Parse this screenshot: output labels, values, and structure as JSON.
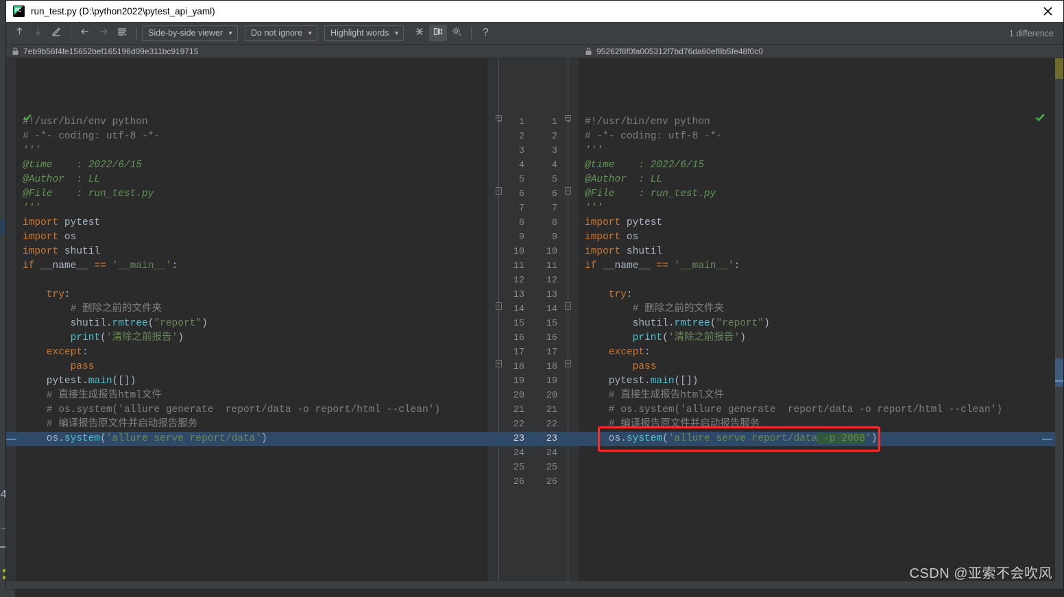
{
  "window": {
    "title": "run_test.py (D:\\python2022\\pytest_api_yaml)",
    "app_icon": "pycharm-icon",
    "close_label": "✕"
  },
  "toolbar": {
    "buttons": [
      {
        "name": "previous-difference-button",
        "icon": "arrow-up-icon",
        "enabled": true
      },
      {
        "name": "next-difference-button",
        "icon": "arrow-down-icon",
        "enabled": false
      },
      {
        "name": "annotate-button",
        "icon": "pencil-icon",
        "enabled": true
      },
      {
        "name": "back-button",
        "icon": "arrow-left-icon",
        "enabled": true
      },
      {
        "name": "forward-button",
        "icon": "arrow-right-icon",
        "enabled": false
      },
      {
        "name": "collapse-unchanged-button",
        "icon": "lines-icon",
        "enabled": true
      }
    ],
    "viewer_mode": "Side-by-side viewer",
    "ignore_policy": "Do not ignore",
    "highlight_policy": "Highlight words",
    "right_buttons": [
      {
        "name": "collapse-all-button",
        "icon": "collapse-icon"
      },
      {
        "name": "toggle-columns-button",
        "icon": "columns-icon",
        "active": true
      },
      {
        "name": "settings-button",
        "icon": "gear-icon"
      },
      {
        "name": "help-button",
        "icon": "question-icon"
      }
    ],
    "difference_count": "1 difference"
  },
  "revisions": {
    "left": "7eb9b56f4fe15652bef165196d09e311bc919715",
    "right": "95262f8f0fa005312f7bd76da60ef8b5fe48f0c0",
    "lock_icon": "lock-icon"
  },
  "editor": {
    "line_numbers": [
      1,
      2,
      3,
      4,
      5,
      6,
      7,
      8,
      9,
      10,
      11,
      12,
      13,
      14,
      15,
      16,
      17,
      18,
      19,
      20,
      21,
      22,
      23,
      24,
      25,
      26
    ],
    "selected_line": 23,
    "left_lines": [
      {
        "n": 1,
        "tokens": [
          {
            "t": "#!/usr/bin/env python",
            "c": "c-cmt"
          }
        ]
      },
      {
        "n": 2,
        "tokens": [
          {
            "t": "# -*- coding: utf-8 -*-",
            "c": "c-cmt"
          }
        ]
      },
      {
        "n": 3,
        "tokens": [
          {
            "t": "'''",
            "c": "c-doc"
          }
        ]
      },
      {
        "n": 4,
        "tokens": [
          {
            "t": "@time    : 2022/6/15",
            "c": "c-doc"
          }
        ]
      },
      {
        "n": 5,
        "tokens": [
          {
            "t": "@Author  : LL",
            "c": "c-doc"
          }
        ]
      },
      {
        "n": 6,
        "tokens": [
          {
            "t": "@File    : run_test.py",
            "c": "c-doc"
          }
        ]
      },
      {
        "n": 7,
        "tokens": [
          {
            "t": "'''",
            "c": "c-doc"
          }
        ]
      },
      {
        "n": 8,
        "tokens": [
          {
            "t": "import ",
            "c": "c-kw"
          },
          {
            "t": "pytest",
            "c": "c-txt"
          }
        ]
      },
      {
        "n": 9,
        "tokens": [
          {
            "t": "import ",
            "c": "c-kw"
          },
          {
            "t": "os",
            "c": "c-txt"
          }
        ]
      },
      {
        "n": 10,
        "tokens": [
          {
            "t": "import ",
            "c": "c-kw"
          },
          {
            "t": "shutil",
            "c": "c-txt"
          }
        ]
      },
      {
        "n": 11,
        "tokens": [
          {
            "t": "if ",
            "c": "c-kw"
          },
          {
            "t": "__name__ ",
            "c": "c-txt"
          },
          {
            "t": "== ",
            "c": "c-kw"
          },
          {
            "t": "'__main__'",
            "c": "c-str"
          },
          {
            "t": ":",
            "c": "c-txt"
          }
        ]
      },
      {
        "n": 12,
        "tokens": []
      },
      {
        "n": 13,
        "tokens": [
          {
            "t": "    try",
            "c": "c-kw"
          },
          {
            "t": ":",
            "c": "c-txt"
          }
        ]
      },
      {
        "n": 14,
        "tokens": [
          {
            "t": "        # 删除之前的文件夹",
            "c": "c-cmt"
          }
        ]
      },
      {
        "n": 15,
        "tokens": [
          {
            "t": "        shutil.",
            "c": "c-txt"
          },
          {
            "t": "rmtree",
            "c": "c-fn"
          },
          {
            "t": "(",
            "c": "c-txt"
          },
          {
            "t": "\"report\"",
            "c": "c-str"
          },
          {
            "t": ")",
            "c": "c-txt"
          }
        ]
      },
      {
        "n": 16,
        "tokens": [
          {
            "t": "        ",
            "c": "c-txt"
          },
          {
            "t": "print",
            "c": "c-fn"
          },
          {
            "t": "(",
            "c": "c-txt"
          },
          {
            "t": "'清除之前报告'",
            "c": "c-str"
          },
          {
            "t": ")",
            "c": "c-txt"
          }
        ]
      },
      {
        "n": 17,
        "tokens": [
          {
            "t": "    except",
            "c": "c-kw"
          },
          {
            "t": ":",
            "c": "c-txt"
          }
        ]
      },
      {
        "n": 18,
        "tokens": [
          {
            "t": "        pass",
            "c": "c-kw"
          }
        ]
      },
      {
        "n": 19,
        "tokens": [
          {
            "t": "    pytest.",
            "c": "c-txt"
          },
          {
            "t": "main",
            "c": "c-fn"
          },
          {
            "t": "([])",
            "c": "c-txt"
          }
        ]
      },
      {
        "n": 20,
        "tokens": [
          {
            "t": "    # 直接生成报告html文件",
            "c": "c-cmt"
          }
        ]
      },
      {
        "n": 21,
        "tokens": [
          {
            "t": "    # os.system('allure generate  report/data -o report/html --clean')",
            "c": "c-cmt"
          }
        ]
      },
      {
        "n": 22,
        "tokens": [
          {
            "t": "    # 编译报告原文件并启动报告服务",
            "c": "c-cmt"
          }
        ]
      },
      {
        "n": 23,
        "tokens": [
          {
            "t": "    os.",
            "c": "c-txt"
          },
          {
            "t": "system",
            "c": "c-fn"
          },
          {
            "t": "(",
            "c": "c-txt"
          },
          {
            "t": "'allure serve report/data'",
            "c": "c-str"
          },
          {
            "t": ")",
            "c": "c-txt"
          }
        ]
      },
      {
        "n": 24,
        "tokens": []
      },
      {
        "n": 25,
        "tokens": []
      },
      {
        "n": 26,
        "tokens": []
      }
    ],
    "right_lines": [
      {
        "n": 1,
        "tokens": [
          {
            "t": "#!/usr/bin/env python",
            "c": "c-cmt"
          }
        ]
      },
      {
        "n": 2,
        "tokens": [
          {
            "t": "# -*- coding: utf-8 -*-",
            "c": "c-cmt"
          }
        ]
      },
      {
        "n": 3,
        "tokens": [
          {
            "t": "'''",
            "c": "c-doc"
          }
        ]
      },
      {
        "n": 4,
        "tokens": [
          {
            "t": "@time    : 2022/6/15",
            "c": "c-doc"
          }
        ]
      },
      {
        "n": 5,
        "tokens": [
          {
            "t": "@Author  : LL",
            "c": "c-doc"
          }
        ]
      },
      {
        "n": 6,
        "tokens": [
          {
            "t": "@File    : run_test.py",
            "c": "c-doc"
          }
        ]
      },
      {
        "n": 7,
        "tokens": [
          {
            "t": "'''",
            "c": "c-doc"
          }
        ]
      },
      {
        "n": 8,
        "tokens": [
          {
            "t": "import ",
            "c": "c-kw"
          },
          {
            "t": "pytest",
            "c": "c-txt"
          }
        ]
      },
      {
        "n": 9,
        "tokens": [
          {
            "t": "import ",
            "c": "c-kw"
          },
          {
            "t": "os",
            "c": "c-txt"
          }
        ]
      },
      {
        "n": 10,
        "tokens": [
          {
            "t": "import ",
            "c": "c-kw"
          },
          {
            "t": "shutil",
            "c": "c-txt"
          }
        ]
      },
      {
        "n": 11,
        "tokens": [
          {
            "t": "if ",
            "c": "c-kw"
          },
          {
            "t": "__name__ ",
            "c": "c-txt"
          },
          {
            "t": "== ",
            "c": "c-kw"
          },
          {
            "t": "'__main__'",
            "c": "c-str"
          },
          {
            "t": ":",
            "c": "c-txt"
          }
        ]
      },
      {
        "n": 12,
        "tokens": []
      },
      {
        "n": 13,
        "tokens": [
          {
            "t": "    try",
            "c": "c-kw"
          },
          {
            "t": ":",
            "c": "c-txt"
          }
        ]
      },
      {
        "n": 14,
        "tokens": [
          {
            "t": "        # 删除之前的文件夹",
            "c": "c-cmt"
          }
        ]
      },
      {
        "n": 15,
        "tokens": [
          {
            "t": "        shutil.",
            "c": "c-txt"
          },
          {
            "t": "rmtree",
            "c": "c-fn"
          },
          {
            "t": "(",
            "c": "c-txt"
          },
          {
            "t": "\"report\"",
            "c": "c-str"
          },
          {
            "t": ")",
            "c": "c-txt"
          }
        ]
      },
      {
        "n": 16,
        "tokens": [
          {
            "t": "        ",
            "c": "c-txt"
          },
          {
            "t": "print",
            "c": "c-fn"
          },
          {
            "t": "(",
            "c": "c-txt"
          },
          {
            "t": "'清除之前报告'",
            "c": "c-str"
          },
          {
            "t": ")",
            "c": "c-txt"
          }
        ]
      },
      {
        "n": 17,
        "tokens": [
          {
            "t": "    except",
            "c": "c-kw"
          },
          {
            "t": ":",
            "c": "c-txt"
          }
        ]
      },
      {
        "n": 18,
        "tokens": [
          {
            "t": "        pass",
            "c": "c-kw"
          }
        ]
      },
      {
        "n": 19,
        "tokens": [
          {
            "t": "    pytest.",
            "c": "c-txt"
          },
          {
            "t": "main",
            "c": "c-fn"
          },
          {
            "t": "([])",
            "c": "c-txt"
          }
        ]
      },
      {
        "n": 20,
        "tokens": [
          {
            "t": "    # 直接生成报告html文件",
            "c": "c-cmt"
          }
        ]
      },
      {
        "n": 21,
        "tokens": [
          {
            "t": "    # os.system('allure generate  report/data -o report/html --clean')",
            "c": "c-cmt"
          }
        ]
      },
      {
        "n": 22,
        "tokens": [
          {
            "t": "    # 编译报告原文件并启动报告服务",
            "c": "c-cmt"
          }
        ]
      },
      {
        "n": 23,
        "tokens": [
          {
            "t": "    os.",
            "c": "c-txt"
          },
          {
            "t": "system",
            "c": "c-fn"
          },
          {
            "t": "(",
            "c": "c-txt"
          },
          {
            "t": "'allure serve report/data",
            "c": "c-str"
          },
          {
            "t": " -p 2008",
            "c": "c-str",
            "ins": true
          },
          {
            "t": "'",
            "c": "c-str"
          },
          {
            "t": ")",
            "c": "c-txt"
          }
        ]
      },
      {
        "n": 24,
        "tokens": []
      },
      {
        "n": 25,
        "tokens": []
      },
      {
        "n": 26,
        "tokens": []
      }
    ]
  },
  "annotation": {
    "red_box_target_line": 23,
    "red_box_color": "#f42c2c"
  },
  "status": {
    "left_inspection": "ok-check",
    "right_inspection": "ok-check"
  },
  "backdrop": {
    "line_hint": "4"
  },
  "watermark": "CSDN @亚索不会吹风",
  "colors": {
    "window_chrome": "#3c3f41",
    "editor_bg": "#2b2b2b",
    "gutter_bg": "#313335",
    "selection": "#2f4a68",
    "inserted": "#32593d",
    "accent_red": "#f42c2c"
  }
}
